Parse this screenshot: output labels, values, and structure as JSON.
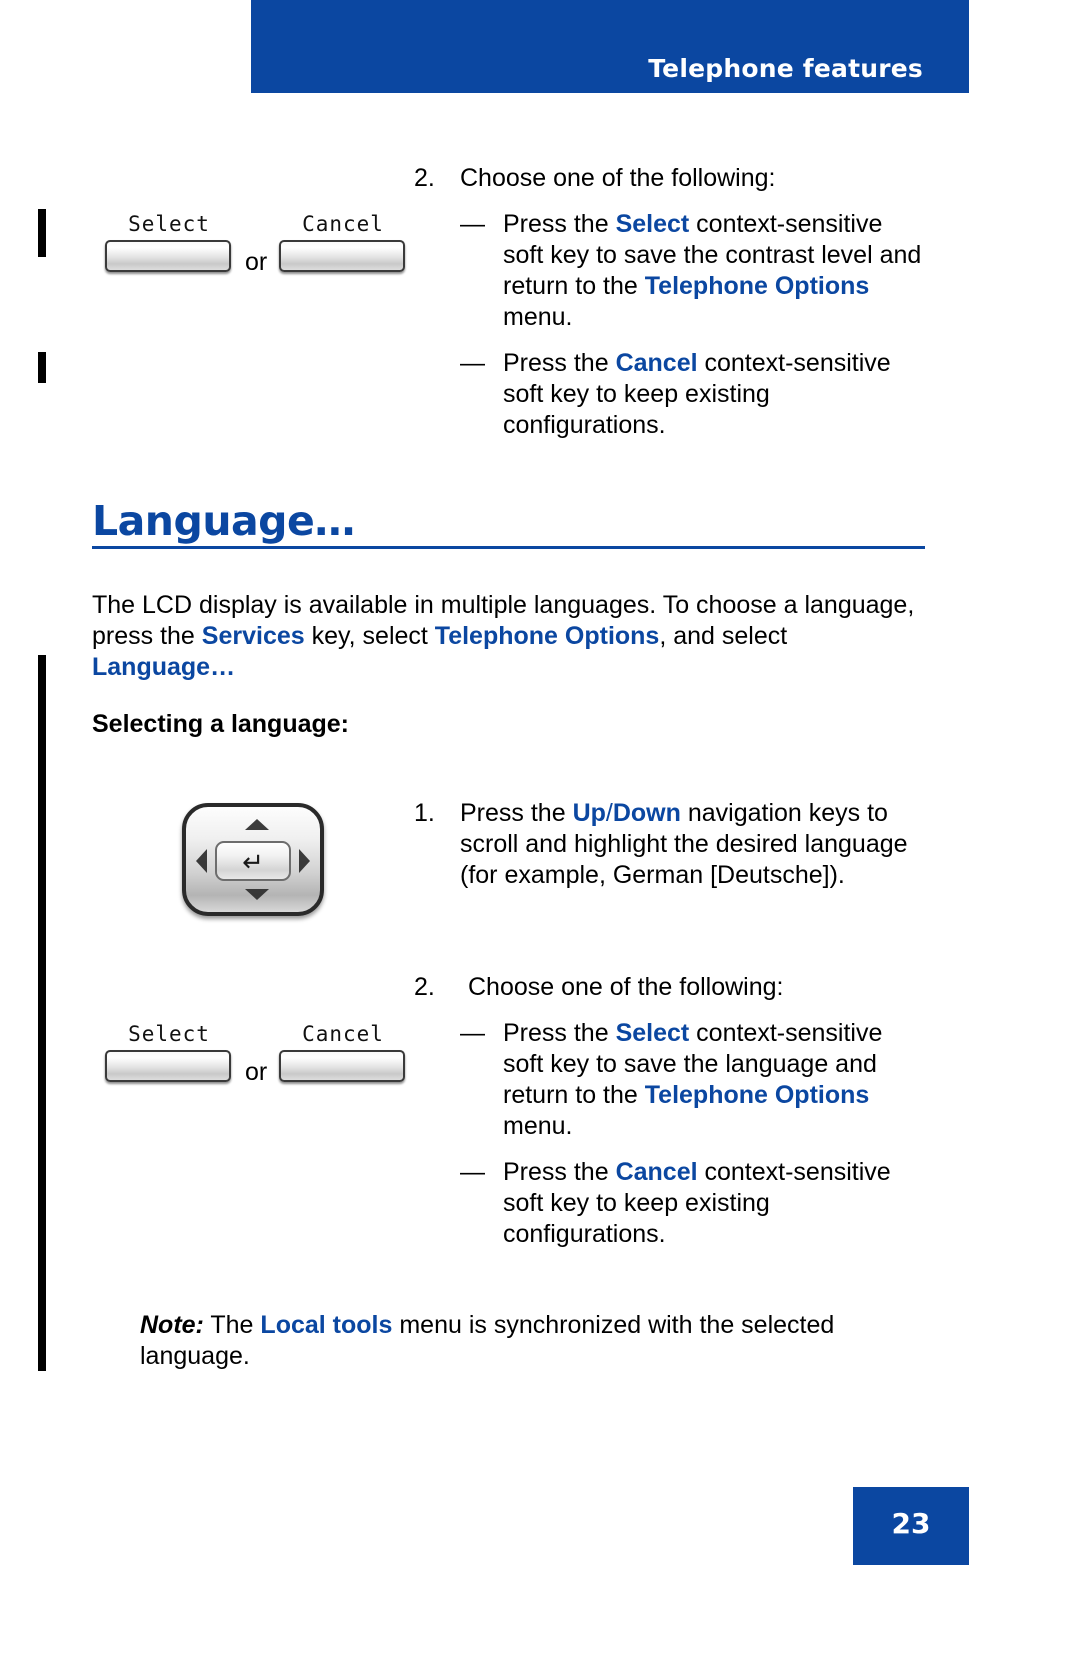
{
  "header": {
    "title": "Telephone features"
  },
  "footer": {
    "page_number": "23",
    "accent_color": "#0b47a1"
  },
  "colors": {
    "accent_blue": "#0b47a1",
    "body_text": "#000000",
    "page_background": "#ffffff"
  },
  "contrast_step": {
    "number": "2.",
    "text": "Choose one of the following:",
    "bullets": [
      {
        "dash": "—",
        "segments": [
          {
            "text": "Press the ",
            "style": "normal"
          },
          {
            "text": "Select",
            "style": "blue-bold"
          },
          {
            "text": " context-sensitive soft key to save the contrast level and return to the ",
            "style": "normal"
          },
          {
            "text": "Telephone Options",
            "style": "blue-bold"
          },
          {
            "text": " menu.",
            "style": "normal"
          }
        ]
      },
      {
        "dash": "—",
        "segments": [
          {
            "text": "Press the ",
            "style": "normal"
          },
          {
            "text": "Cancel",
            "style": "blue-bold"
          },
          {
            "text": " context-sensitive soft key to keep existing configurations.",
            "style": "normal"
          }
        ]
      }
    ]
  },
  "softkeys_top": {
    "left_label": "Select",
    "right_label": "Cancel",
    "separator": "or"
  },
  "softkeys_bottom": {
    "left_label": "Select",
    "right_label": "Cancel",
    "separator": "or"
  },
  "section": {
    "heading": "Language…",
    "intro": {
      "segments": [
        {
          "text": "The LCD display is available in multiple languages. To choose a language, press the ",
          "style": "normal"
        },
        {
          "text": "Services",
          "style": "blue-bold"
        },
        {
          "text": " key, select ",
          "style": "normal"
        },
        {
          "text": "Telephone Options",
          "style": "blue-bold"
        },
        {
          "text": ", and select ",
          "style": "normal"
        },
        {
          "text": "Language…",
          "style": "blue-bold"
        }
      ]
    },
    "sub_heading": "Selecting a language:"
  },
  "language_step_1": {
    "number": "1.",
    "segments": [
      {
        "text": "Press the ",
        "style": "normal"
      },
      {
        "text": "Up",
        "style": "blue-bold"
      },
      {
        "text": "/",
        "style": "blue-normal"
      },
      {
        "text": "Down",
        "style": "blue-bold"
      },
      {
        "text": " navigation keys to scroll and highlight the desired language (for example, German [Deutsche]).",
        "style": "normal"
      }
    ]
  },
  "navigation_key": {
    "up_icon": "triangle-up-icon",
    "down_icon": "triangle-down-icon",
    "left_icon": "triangle-left-icon",
    "right_icon": "triangle-right-icon",
    "enter_glyph": "↵"
  },
  "language_step_2": {
    "number": "2.",
    "text": "Choose one of the following:",
    "bullets": [
      {
        "dash": "—",
        "segments": [
          {
            "text": "Press the ",
            "style": "normal"
          },
          {
            "text": "Select",
            "style": "blue-bold"
          },
          {
            "text": " context-sensitive soft key to save the language and return to the ",
            "style": "normal"
          },
          {
            "text": "Telephone Options",
            "style": "blue-bold"
          },
          {
            "text": " menu.",
            "style": "normal"
          }
        ]
      },
      {
        "dash": "—",
        "segments": [
          {
            "text": "Press the ",
            "style": "normal"
          },
          {
            "text": "Cancel",
            "style": "blue-bold"
          },
          {
            "text": " context-sensitive soft key to keep existing configurations.",
            "style": "normal"
          }
        ]
      }
    ]
  },
  "note": {
    "label": "Note:",
    "segments": [
      {
        "text": " The ",
        "style": "normal"
      },
      {
        "text": "Local tools",
        "style": "blue-bold"
      },
      {
        "text": " menu is synchronized with the selected language.",
        "style": "normal"
      }
    ]
  }
}
